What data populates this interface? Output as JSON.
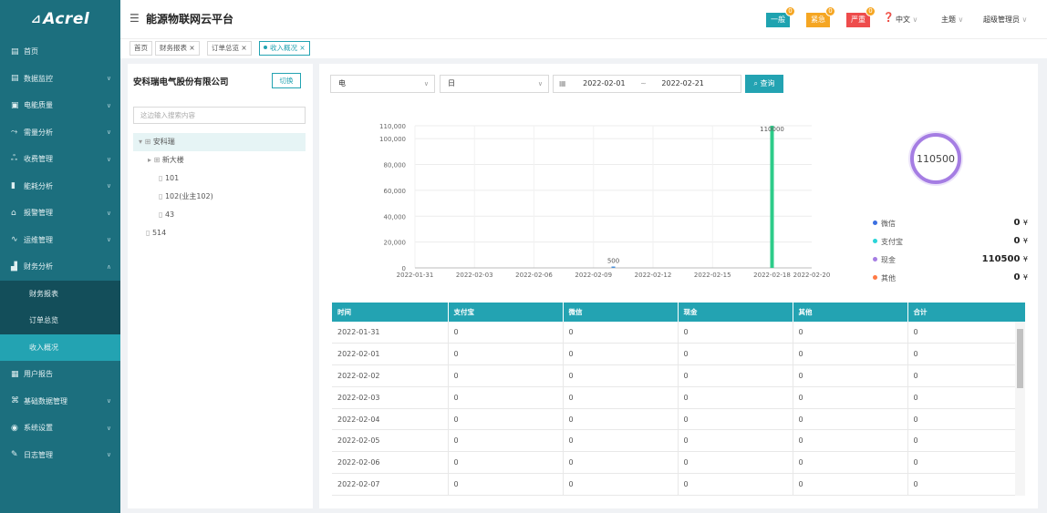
{
  "brand": "Acrel",
  "app_title": "能源物联网云平台",
  "alerts": [
    {
      "label": "一般",
      "count": "0",
      "color": "#1fa3b0"
    },
    {
      "label": "紧急",
      "count": "0",
      "color": "#f5a623"
    },
    {
      "label": "严重",
      "count": "0",
      "color": "#ee4c4c"
    }
  ],
  "topright": {
    "lang": "中文",
    "theme": "主题",
    "user": "超级管理员"
  },
  "sidebar": {
    "items": [
      {
        "label": "首页",
        "icon": "monitor-icon"
      },
      {
        "label": "数据监控",
        "icon": "monitor-icon"
      },
      {
        "label": "电能质量",
        "icon": "monitor-icon"
      },
      {
        "label": "需量分析",
        "icon": "trend-icon"
      },
      {
        "label": "收费管理",
        "icon": "user-icon"
      },
      {
        "label": "能耗分析",
        "icon": "bar-chart-icon"
      },
      {
        "label": "报警管理",
        "icon": "alarm-icon"
      },
      {
        "label": "运维管理",
        "icon": "wave-icon"
      },
      {
        "label": "财务分析",
        "icon": "finance-icon"
      },
      {
        "label": "财务报表"
      },
      {
        "label": "订单总览"
      },
      {
        "label": "收入概况"
      },
      {
        "label": "用户报告",
        "icon": "report-icon"
      },
      {
        "label": "基础数据管理",
        "icon": "network-icon"
      },
      {
        "label": "系统设置",
        "icon": "settings-icon"
      },
      {
        "label": "日志管理",
        "icon": "log-icon"
      }
    ]
  },
  "tabs": [
    "首页",
    "财务报表",
    "订单总览",
    "收入概况"
  ],
  "left": {
    "company": "安科瑞电气股份有限公司",
    "switch_label": "切换",
    "search_placeholder": "这边输入搜索内容",
    "tree": [
      "安科瑞",
      "新大楼",
      "101",
      "102(业主102)",
      "43",
      "514"
    ]
  },
  "filters": {
    "energy": "电",
    "period": "日",
    "start": "2022-02-01",
    "sep": "~",
    "end": "2022-02-21",
    "query": "查询"
  },
  "chart_data": {
    "type": "bar",
    "categories": [
      "2022-01-31",
      "2022-02-01",
      "2022-02-02",
      "2022-02-03",
      "2022-02-04",
      "2022-02-05",
      "2022-02-06",
      "2022-02-07",
      "2022-02-08",
      "2022-02-09",
      "2022-02-10",
      "2022-02-11",
      "2022-02-12",
      "2022-02-13",
      "2022-02-14",
      "2022-02-15",
      "2022-02-16",
      "2022-02-17",
      "2022-02-18",
      "2022-02-19",
      "2022-02-20"
    ],
    "x_tick_labels": [
      "2022-01-31",
      "2022-02-03",
      "2022-02-06",
      "2022-02-09",
      "2022-02-12",
      "2022-02-15",
      "2022-02-18",
      "2022-02-20"
    ],
    "values": [
      0,
      0,
      0,
      0,
      0,
      0,
      0,
      0,
      0,
      0,
      500,
      0,
      0,
      0,
      0,
      0,
      0,
      0,
      110000,
      0,
      0
    ],
    "data_labels": [
      {
        "index": 10,
        "text": "500"
      },
      {
        "index": 18,
        "text": "110000"
      }
    ],
    "y_ticks": [
      "0",
      "20,000",
      "40,000",
      "60,000",
      "80,000",
      "100,000",
      "110,000"
    ],
    "ylim": [
      0,
      110000
    ],
    "grid": true,
    "bar_color": "#2ecc8a",
    "small_bar_color": "#4a90d9"
  },
  "summary_total": "110500",
  "legend": [
    {
      "label": "微信",
      "value": "0",
      "color": "#3b6fe0"
    },
    {
      "label": "支付宝",
      "value": "0",
      "color": "#2ad4d8"
    },
    {
      "label": "现金",
      "value": "110500",
      "color": "#a57de3"
    },
    {
      "label": "其他",
      "value": "0",
      "color": "#ff7a45"
    }
  ],
  "currency": "¥",
  "table": {
    "headers": [
      "时间",
      "支付宝",
      "微信",
      "现金",
      "其他",
      "合计"
    ],
    "rows": [
      [
        "2022-01-31",
        "0",
        "0",
        "0",
        "0",
        "0"
      ],
      [
        "2022-02-01",
        "0",
        "0",
        "0",
        "0",
        "0"
      ],
      [
        "2022-02-02",
        "0",
        "0",
        "0",
        "0",
        "0"
      ],
      [
        "2022-02-03",
        "0",
        "0",
        "0",
        "0",
        "0"
      ],
      [
        "2022-02-04",
        "0",
        "0",
        "0",
        "0",
        "0"
      ],
      [
        "2022-02-05",
        "0",
        "0",
        "0",
        "0",
        "0"
      ],
      [
        "2022-02-06",
        "0",
        "0",
        "0",
        "0",
        "0"
      ],
      [
        "2022-02-07",
        "0",
        "0",
        "0",
        "0",
        "0"
      ]
    ]
  }
}
